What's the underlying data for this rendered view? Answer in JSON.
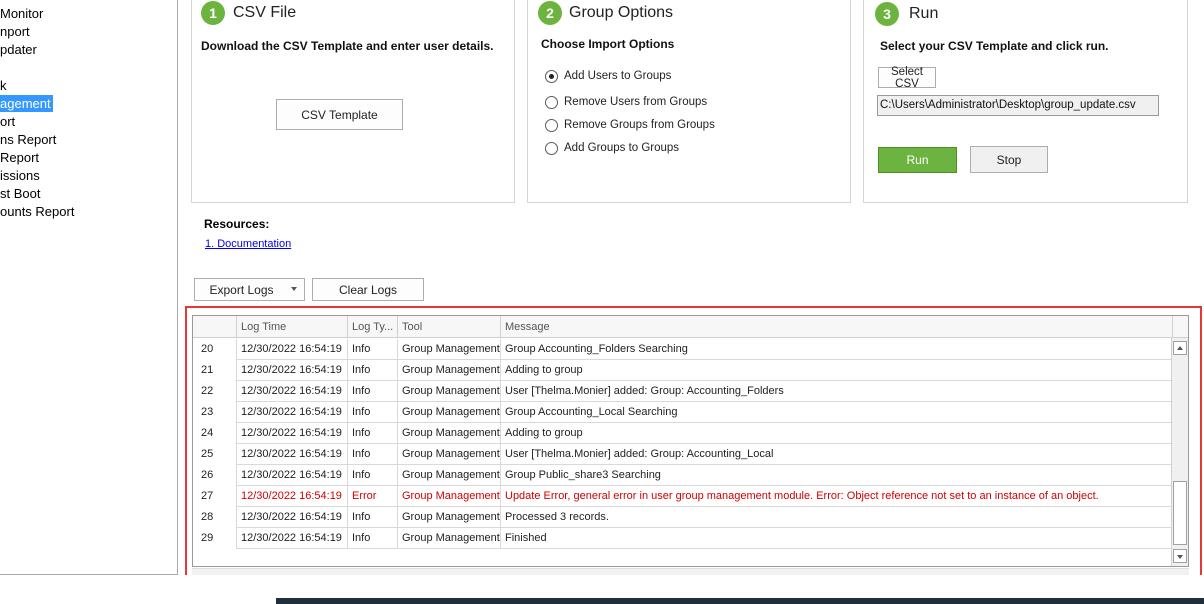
{
  "sidebar": {
    "items": [
      {
        "label": "Monitor",
        "selected": false
      },
      {
        "label": "nport",
        "selected": false
      },
      {
        "label": "pdater",
        "selected": false
      },
      {
        "label": "k",
        "selected": false
      },
      {
        "label": "agement",
        "selected": true
      },
      {
        "label": "ort",
        "selected": false
      },
      {
        "label": "ns Report",
        "selected": false
      },
      {
        "label": "Report",
        "selected": false
      },
      {
        "label": "issions",
        "selected": false
      },
      {
        "label": "st Boot",
        "selected": false
      },
      {
        "label": "ounts Report",
        "selected": false
      }
    ]
  },
  "steps": {
    "csv": {
      "number": "1",
      "title": "CSV File",
      "subtitle": "Download the CSV Template and enter user details.",
      "template_button": "CSV Template"
    },
    "options": {
      "number": "2",
      "title": "Group Options",
      "subtitle": "Choose Import Options",
      "radios": [
        {
          "label": "Add Users to Groups",
          "checked": true
        },
        {
          "label": "Remove Users from Groups",
          "checked": false
        },
        {
          "label": "Remove Groups from Groups",
          "checked": false
        },
        {
          "label": "Add Groups to Groups",
          "checked": false
        }
      ]
    },
    "run": {
      "number": "3",
      "title": "Run",
      "subtitle": "Select your CSV Template and click run.",
      "select_button": "Select CSV",
      "path_value": "C:\\Users\\Administrator\\Desktop\\group_update.csv",
      "run_button": "Run",
      "stop_button": "Stop"
    }
  },
  "resources": {
    "label": "Resources:",
    "links": [
      "1. Documentation"
    ]
  },
  "logs_toolbar": {
    "export_label": "Export Logs",
    "clear_label": "Clear Logs"
  },
  "log_grid": {
    "headers": [
      "",
      "Log Time",
      "Log Ty...",
      "Tool",
      "Message"
    ],
    "rows": [
      {
        "n": "20",
        "time": "12/30/2022 16:54:19",
        "type": "Info",
        "tool": "Group Management",
        "message": "Group Accounting_Folders Searching"
      },
      {
        "n": "21",
        "time": "12/30/2022 16:54:19",
        "type": "Info",
        "tool": "Group Management",
        "message": "Adding to group"
      },
      {
        "n": "22",
        "time": "12/30/2022 16:54:19",
        "type": "Info",
        "tool": "Group Management",
        "message": "User [Thelma.Monier] added: Group: Accounting_Folders"
      },
      {
        "n": "23",
        "time": "12/30/2022 16:54:19",
        "type": "Info",
        "tool": "Group Management",
        "message": "Group Accounting_Local Searching"
      },
      {
        "n": "24",
        "time": "12/30/2022 16:54:19",
        "type": "Info",
        "tool": "Group Management",
        "message": "Adding to group"
      },
      {
        "n": "25",
        "time": "12/30/2022 16:54:19",
        "type": "Info",
        "tool": "Group Management",
        "message": "User [Thelma.Monier] added: Group: Accounting_Local"
      },
      {
        "n": "26",
        "time": "12/30/2022 16:54:19",
        "type": "Info",
        "tool": "Group Management",
        "message": "Group Public_share3 Searching"
      },
      {
        "n": "27",
        "time": "12/30/2022 16:54:19",
        "type": "Error",
        "tool": "Group Management",
        "message": "Update Error, general error in user group management module. Error: Object reference not set to an instance of an object."
      },
      {
        "n": "28",
        "time": "12/30/2022 16:54:19",
        "type": "Info",
        "tool": "Group Management",
        "message": "Processed 3 records."
      },
      {
        "n": "29",
        "time": "12/30/2022 16:54:19",
        "type": "Info",
        "tool": "Group Management",
        "message": "Finished"
      }
    ]
  },
  "colors": {
    "accent_green": "#6db33f",
    "selection_blue": "#3399ff",
    "error_red": "#d00000",
    "highlight_red": "#e53935"
  }
}
